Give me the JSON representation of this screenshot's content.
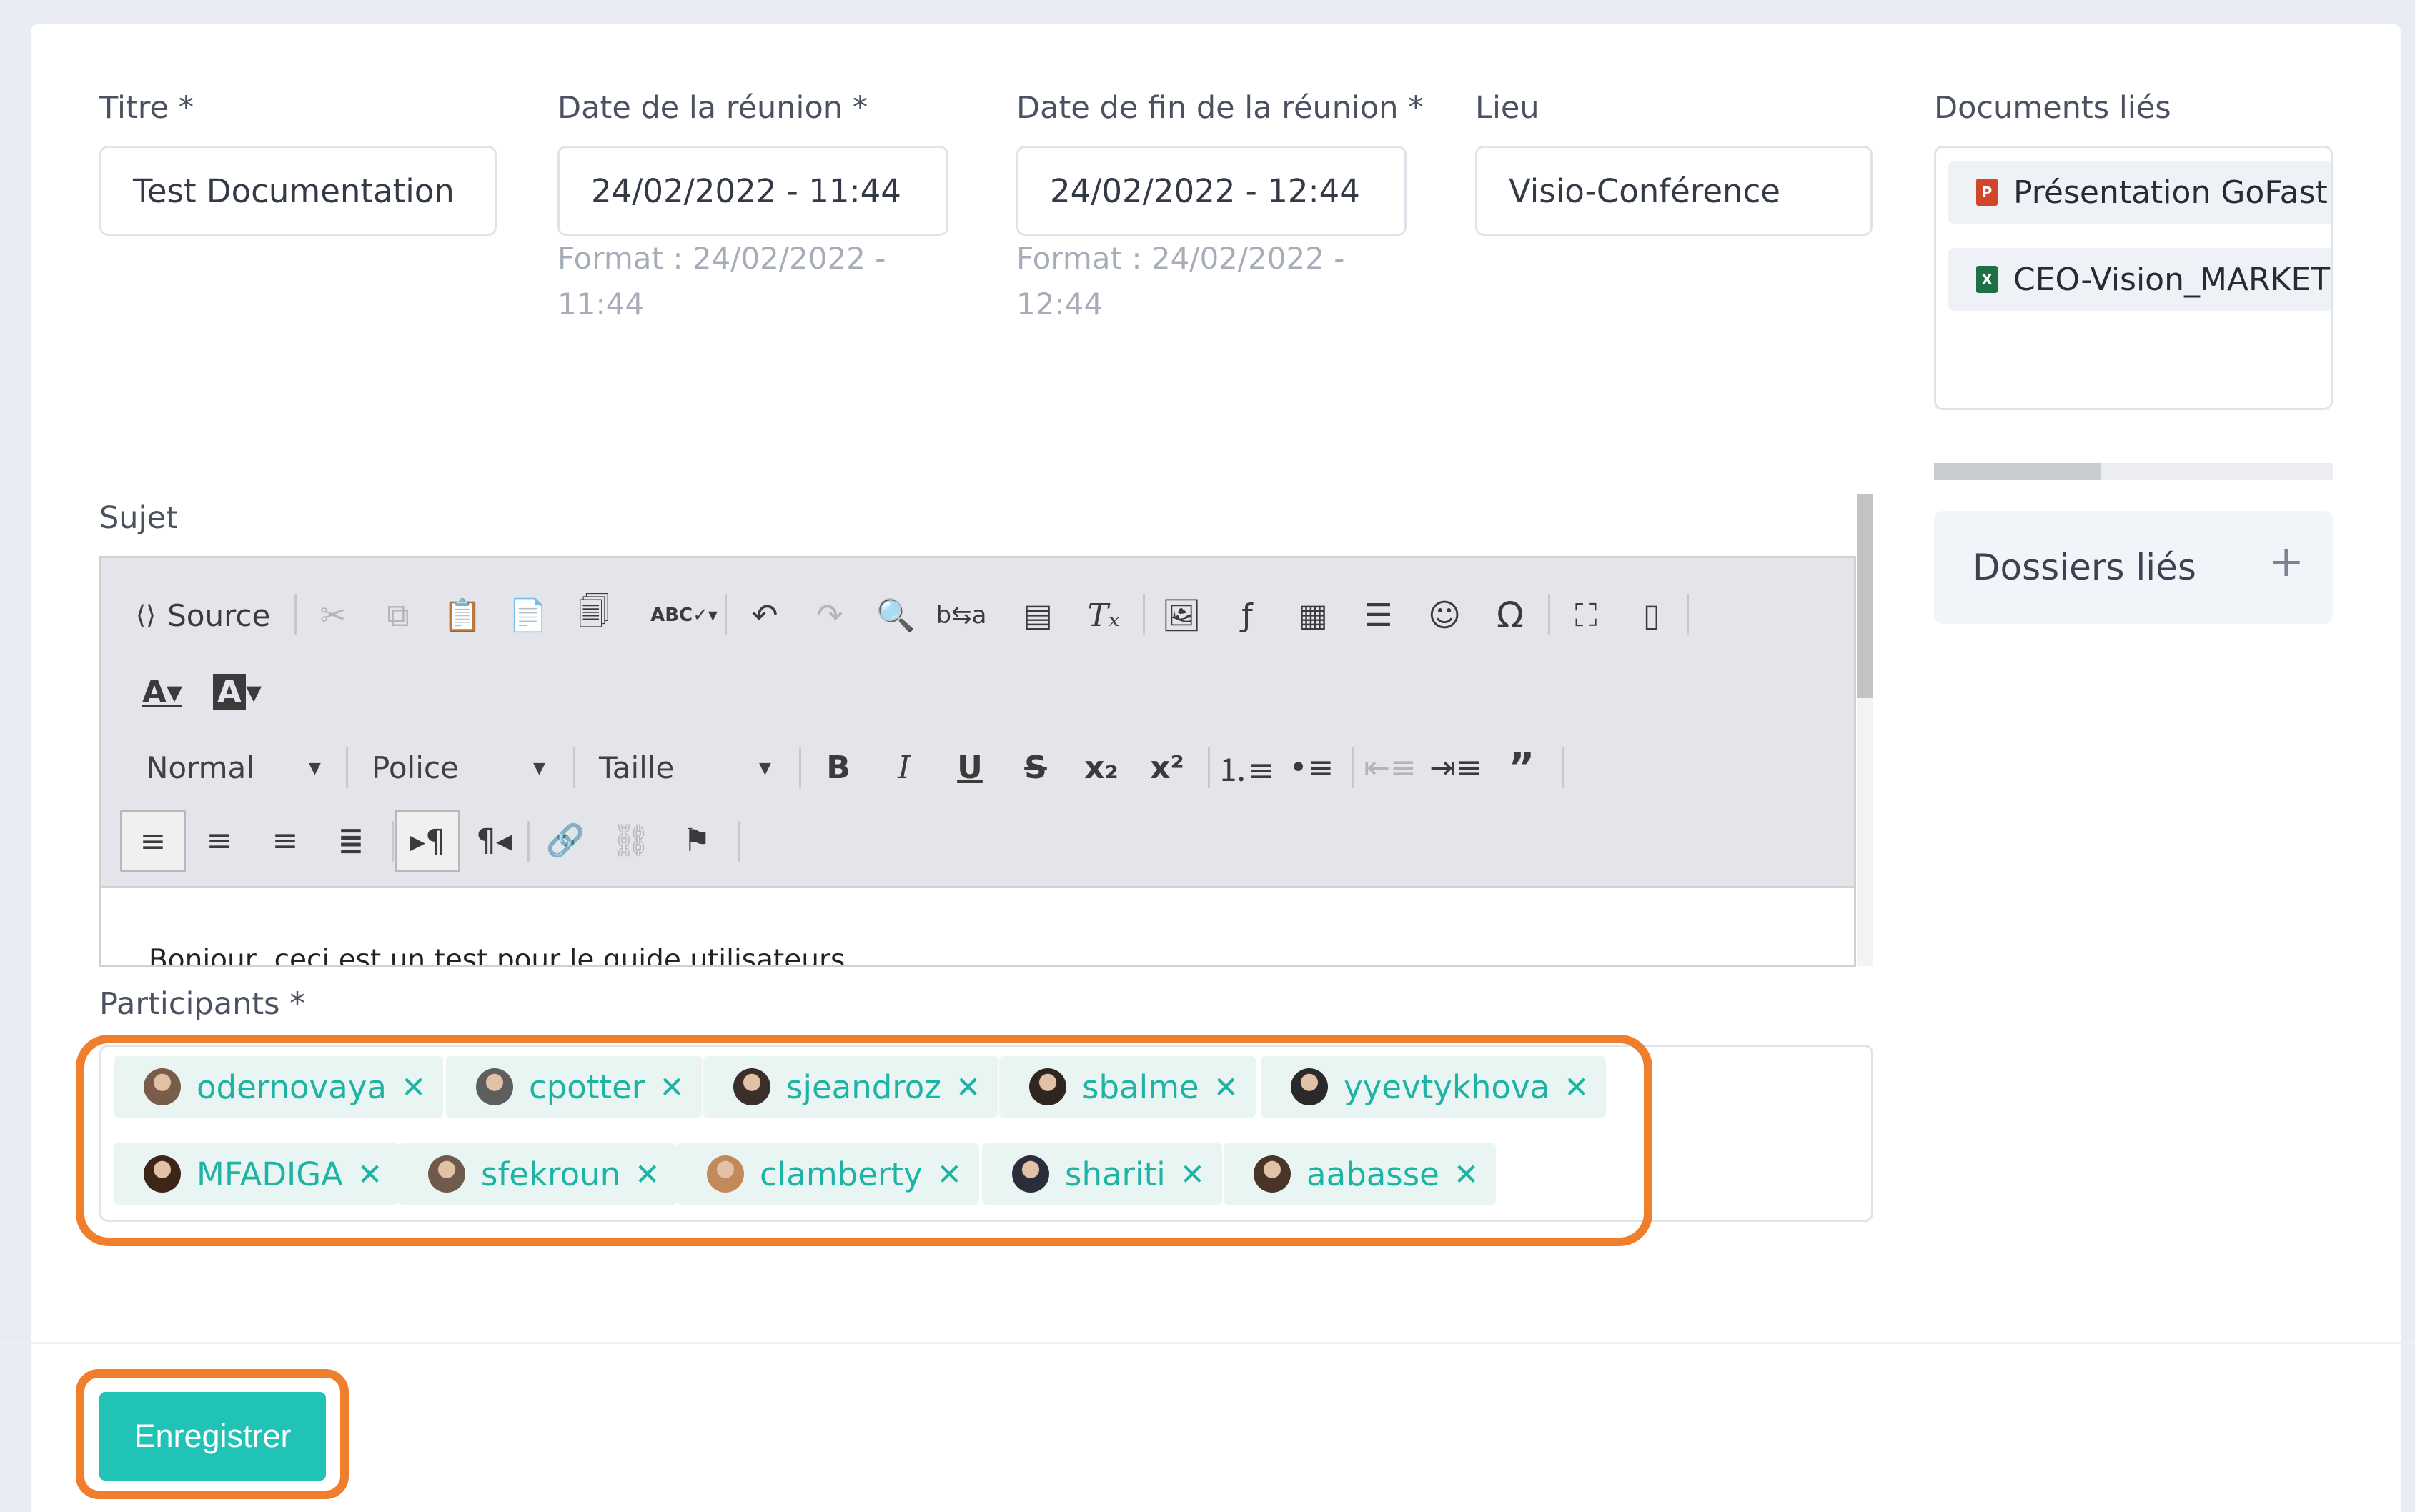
{
  "fields": {
    "titre": {
      "label": "Titre *",
      "value": "Test Documentation"
    },
    "date_debut": {
      "label": "Date de la réunion *",
      "value": "24/02/2022 - 11:44",
      "hint_line1": "Format : 24/02/2022 -",
      "hint_line2": "11:44"
    },
    "date_fin": {
      "label": "Date de fin de la réunion *",
      "value": "24/02/2022 - 12:44",
      "hint_line1": "Format : 24/02/2022 -",
      "hint_line2": "12:44"
    },
    "lieu": {
      "label": "Lieu",
      "value": "Visio-Conférence"
    }
  },
  "documents": {
    "label": "Documents liés",
    "items": [
      {
        "name": "Présentation GoFast /",
        "type": "powerpoint",
        "color": "#d2452b",
        "glyph": "P"
      },
      {
        "name": "CEO-Vision_MARKETI",
        "type": "excel",
        "color": "#1e7145",
        "glyph": "X"
      }
    ],
    "scroll_fraction": 0.42
  },
  "dossiers": {
    "label": "Dossiers liés",
    "add": "+"
  },
  "sujet": {
    "label": "Sujet",
    "toolbar": {
      "source": "Source",
      "format": "Normal",
      "font": "Police",
      "size": "Taille"
    },
    "content": "Bonjour, ceci est un test pour le guide utilisateurs"
  },
  "participants": {
    "label": "Participants *",
    "items": [
      {
        "name": "odernovaya"
      },
      {
        "name": "cpotter"
      },
      {
        "name": "sjeandroz"
      },
      {
        "name": "sbalme"
      },
      {
        "name": "yyevtykhova"
      },
      {
        "name": "MFADIGA"
      },
      {
        "name": "sfekroun"
      },
      {
        "name": "clamberty"
      },
      {
        "name": "shariti"
      },
      {
        "name": "aabasse"
      }
    ],
    "remove_glyph": "✕"
  },
  "actions": {
    "save": "Enregistrer"
  },
  "colors": {
    "accent": "#21c3b6",
    "highlight": "#f07f2d"
  }
}
